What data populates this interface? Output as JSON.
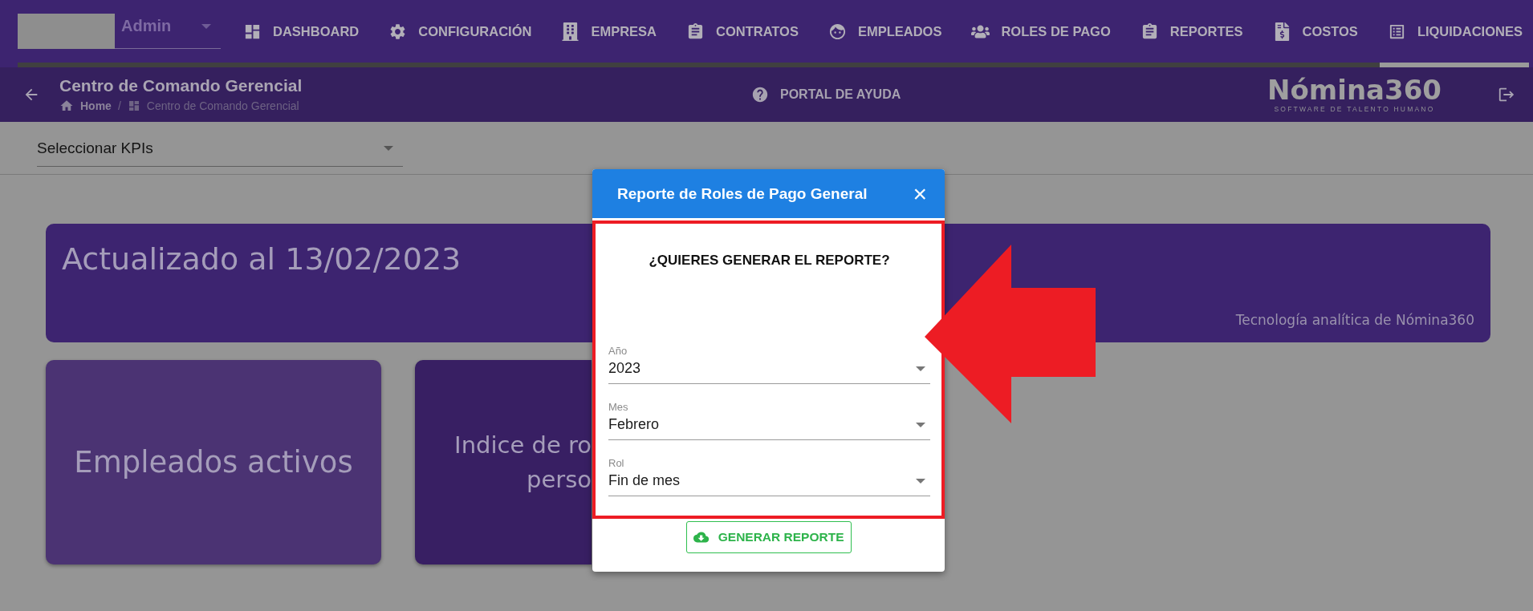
{
  "nav": {
    "user": "Admin",
    "tabs": [
      {
        "label": "DASHBOARD",
        "selected": false
      },
      {
        "label": "CONFIGURACIÓN",
        "selected": false
      },
      {
        "label": "EMPRESA",
        "selected": false
      },
      {
        "label": "CONTRATOS",
        "selected": false
      },
      {
        "label": "EMPLEADOS",
        "selected": false
      },
      {
        "label": "ROLES DE PAGO",
        "selected": false
      },
      {
        "label": "REPORTES",
        "selected": false
      },
      {
        "label": "COSTOS",
        "selected": false
      },
      {
        "label": "LIQUIDACIONES",
        "selected": true
      }
    ]
  },
  "header": {
    "title": "Centro de Comando Gerencial",
    "breadcrumb": [
      "Home",
      "Centro de Comando Gerencial"
    ],
    "separator": "/",
    "help": "PORTAL DE AYUDA",
    "logo": "Nómina360",
    "tagline": "SOFTWARE DE TALENTO HUMANO"
  },
  "kpi_select": {
    "value": "Seleccionar KPIs"
  },
  "banner": {
    "title": "Actualizado al 13/02/2023",
    "subtitle": "Tecnología analítica de Nómina360"
  },
  "cards": [
    {
      "lines": [
        "Empleados activos"
      ]
    },
    {
      "lines": [
        "Indice de ro",
        "perso"
      ]
    }
  ],
  "dialog": {
    "title": "Reporte de Roles de Pago General",
    "close": "×",
    "question": "¿QUIERES GENERAR EL REPORTE?",
    "fields": [
      {
        "label": "Año",
        "value": "2023"
      },
      {
        "label": "Mes",
        "value": "Febrero"
      },
      {
        "label": "Rol",
        "value": "Fin de mes"
      }
    ],
    "button": "GENERAR REPORTE"
  }
}
